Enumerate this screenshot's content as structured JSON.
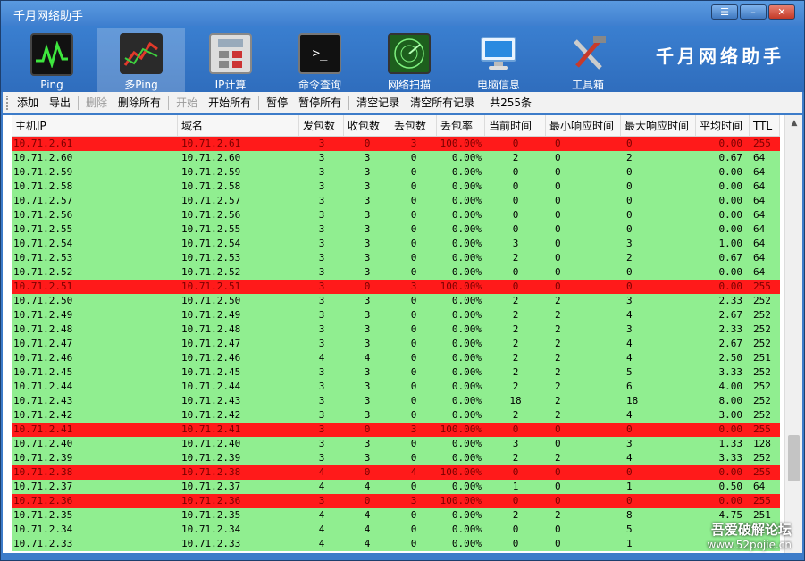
{
  "window": {
    "title": "千月网络助手",
    "brand": "千月网络助手"
  },
  "big_toolbar": [
    {
      "label": "Ping",
      "icon": "ping-icon"
    },
    {
      "label": "多Ping",
      "icon": "multi-ping-icon",
      "active": true
    },
    {
      "label": "IP计算",
      "icon": "calculator-icon"
    },
    {
      "label": "命令查询",
      "icon": "terminal-icon"
    },
    {
      "label": "网络扫描",
      "icon": "radar-icon"
    },
    {
      "label": "电脑信息",
      "icon": "monitor-icon"
    },
    {
      "label": "工具箱",
      "icon": "tools-icon"
    }
  ],
  "small_toolbar": {
    "add": "添加",
    "export": "导出",
    "delete": "删除",
    "delete_all": "删除所有",
    "start": "开始",
    "start_all": "开始所有",
    "pause": "暂停",
    "pause_all": "暂停所有",
    "clear": "清空记录",
    "clear_all": "清空所有记录",
    "count": "共255条"
  },
  "columns": [
    "主机IP",
    "域名",
    "发包数",
    "收包数",
    "丢包数",
    "丢包率",
    "当前时间",
    "最小响应时间",
    "最大响应时间",
    "平均时间",
    "TTL"
  ],
  "rows": [
    [
      "10.71.2.61",
      "10.71.2.61",
      "3",
      "0",
      "3",
      "100.00%",
      "0",
      "0",
      "0",
      "0.00",
      "255",
      "fail"
    ],
    [
      "10.71.2.60",
      "10.71.2.60",
      "3",
      "3",
      "0",
      "0.00%",
      "2",
      "0",
      "2",
      "0.67",
      "64",
      "ok"
    ],
    [
      "10.71.2.59",
      "10.71.2.59",
      "3",
      "3",
      "0",
      "0.00%",
      "0",
      "0",
      "0",
      "0.00",
      "64",
      "ok"
    ],
    [
      "10.71.2.58",
      "10.71.2.58",
      "3",
      "3",
      "0",
      "0.00%",
      "0",
      "0",
      "0",
      "0.00",
      "64",
      "ok"
    ],
    [
      "10.71.2.57",
      "10.71.2.57",
      "3",
      "3",
      "0",
      "0.00%",
      "0",
      "0",
      "0",
      "0.00",
      "64",
      "ok"
    ],
    [
      "10.71.2.56",
      "10.71.2.56",
      "3",
      "3",
      "0",
      "0.00%",
      "0",
      "0",
      "0",
      "0.00",
      "64",
      "ok"
    ],
    [
      "10.71.2.55",
      "10.71.2.55",
      "3",
      "3",
      "0",
      "0.00%",
      "0",
      "0",
      "0",
      "0.00",
      "64",
      "ok"
    ],
    [
      "10.71.2.54",
      "10.71.2.54",
      "3",
      "3",
      "0",
      "0.00%",
      "3",
      "0",
      "3",
      "1.00",
      "64",
      "ok"
    ],
    [
      "10.71.2.53",
      "10.71.2.53",
      "3",
      "3",
      "0",
      "0.00%",
      "2",
      "0",
      "2",
      "0.67",
      "64",
      "ok"
    ],
    [
      "10.71.2.52",
      "10.71.2.52",
      "3",
      "3",
      "0",
      "0.00%",
      "0",
      "0",
      "0",
      "0.00",
      "64",
      "ok"
    ],
    [
      "10.71.2.51",
      "10.71.2.51",
      "3",
      "0",
      "3",
      "100.00%",
      "0",
      "0",
      "0",
      "0.00",
      "255",
      "fail"
    ],
    [
      "10.71.2.50",
      "10.71.2.50",
      "3",
      "3",
      "0",
      "0.00%",
      "2",
      "2",
      "3",
      "2.33",
      "252",
      "ok"
    ],
    [
      "10.71.2.49",
      "10.71.2.49",
      "3",
      "3",
      "0",
      "0.00%",
      "2",
      "2",
      "4",
      "2.67",
      "252",
      "ok"
    ],
    [
      "10.71.2.48",
      "10.71.2.48",
      "3",
      "3",
      "0",
      "0.00%",
      "2",
      "2",
      "3",
      "2.33",
      "252",
      "ok"
    ],
    [
      "10.71.2.47",
      "10.71.2.47",
      "3",
      "3",
      "0",
      "0.00%",
      "2",
      "2",
      "4",
      "2.67",
      "252",
      "ok"
    ],
    [
      "10.71.2.46",
      "10.71.2.46",
      "4",
      "4",
      "0",
      "0.00%",
      "2",
      "2",
      "4",
      "2.50",
      "251",
      "ok"
    ],
    [
      "10.71.2.45",
      "10.71.2.45",
      "3",
      "3",
      "0",
      "0.00%",
      "2",
      "2",
      "5",
      "3.33",
      "252",
      "ok"
    ],
    [
      "10.71.2.44",
      "10.71.2.44",
      "3",
      "3",
      "0",
      "0.00%",
      "2",
      "2",
      "6",
      "4.00",
      "252",
      "ok"
    ],
    [
      "10.71.2.43",
      "10.71.2.43",
      "3",
      "3",
      "0",
      "0.00%",
      "18",
      "2",
      "18",
      "8.00",
      "252",
      "ok"
    ],
    [
      "10.71.2.42",
      "10.71.2.42",
      "3",
      "3",
      "0",
      "0.00%",
      "2",
      "2",
      "4",
      "3.00",
      "252",
      "ok"
    ],
    [
      "10.71.2.41",
      "10.71.2.41",
      "3",
      "0",
      "3",
      "100.00%",
      "0",
      "0",
      "0",
      "0.00",
      "255",
      "fail"
    ],
    [
      "10.71.2.40",
      "10.71.2.40",
      "3",
      "3",
      "0",
      "0.00%",
      "3",
      "0",
      "3",
      "1.33",
      "128",
      "ok"
    ],
    [
      "10.71.2.39",
      "10.71.2.39",
      "3",
      "3",
      "0",
      "0.00%",
      "2",
      "2",
      "4",
      "3.33",
      "252",
      "ok"
    ],
    [
      "10.71.2.38",
      "10.71.2.38",
      "4",
      "0",
      "4",
      "100.00%",
      "0",
      "0",
      "0",
      "0.00",
      "255",
      "fail"
    ],
    [
      "10.71.2.37",
      "10.71.2.37",
      "4",
      "4",
      "0",
      "0.00%",
      "1",
      "0",
      "1",
      "0.50",
      "64",
      "ok"
    ],
    [
      "10.71.2.36",
      "10.71.2.36",
      "3",
      "0",
      "3",
      "100.00%",
      "0",
      "0",
      "0",
      "0.00",
      "255",
      "fail"
    ],
    [
      "10.71.2.35",
      "10.71.2.35",
      "4",
      "4",
      "0",
      "0.00%",
      "2",
      "2",
      "8",
      "4.75",
      "251",
      "ok"
    ],
    [
      "10.71.2.34",
      "10.71.2.34",
      "4",
      "4",
      "0",
      "0.00%",
      "0",
      "0",
      "5",
      "",
      "",
      "ok"
    ],
    [
      "10.71.2.33",
      "10.71.2.33",
      "4",
      "4",
      "0",
      "0.00%",
      "0",
      "0",
      "1",
      "",
      "",
      "ok"
    ]
  ],
  "watermark": {
    "line1": "吾爱破解论坛",
    "line2": "www.52pojie.cn"
  }
}
